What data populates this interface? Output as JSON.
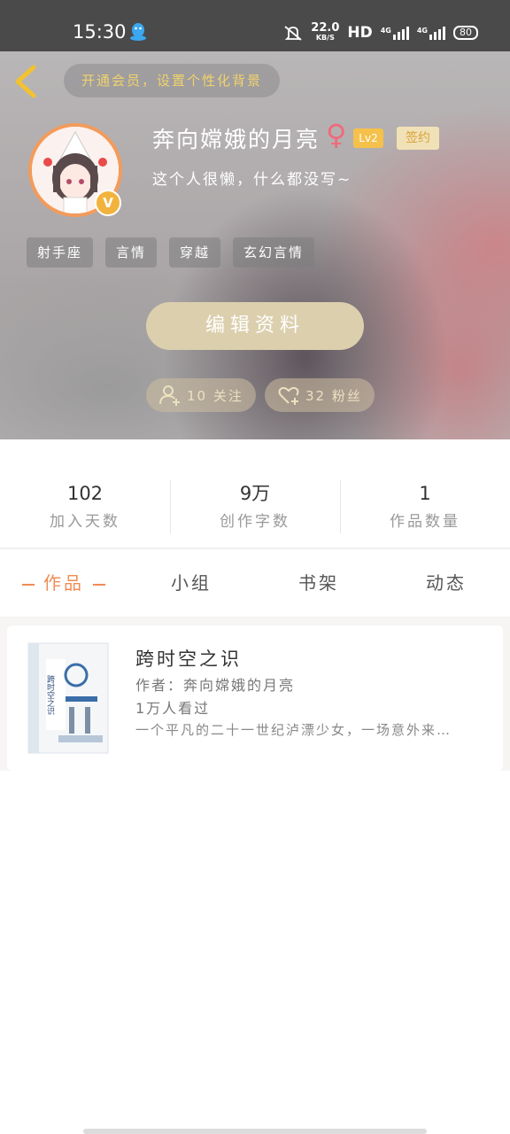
{
  "status_bar": {
    "time": "15:30",
    "speed_value": "22.0",
    "speed_unit": "KB/S",
    "hd": "HD",
    "signal1_label": "4G",
    "signal2_label": "4G",
    "battery": "80"
  },
  "header": {
    "vip_prompt": "开通会员，设置个性化背景",
    "username": "奔向嫦娥的月亮",
    "gender_symbol": "♀",
    "level": "Lv2",
    "signed_badge": "签约",
    "bio": "这个人很懒，什么都没写~",
    "avatar_badge": "V",
    "tags": [
      "射手座",
      "言情",
      "穿越",
      "玄幻言情"
    ],
    "edit_button": "编辑资料",
    "following": "10 关注",
    "followers": "32 粉丝"
  },
  "stats": [
    {
      "value": "102",
      "label": "加入天数"
    },
    {
      "value": "9万",
      "label": "创作字数"
    },
    {
      "value": "1",
      "label": "作品数量"
    }
  ],
  "tabs": [
    {
      "label": "作品",
      "active": true
    },
    {
      "label": "小组",
      "active": false
    },
    {
      "label": "书架",
      "active": false
    },
    {
      "label": "动态",
      "active": false
    }
  ],
  "works": [
    {
      "title": "跨时空之识",
      "author": "作者：奔向嫦娥的月亮",
      "views": "1万人看过",
      "description": "一个平凡的二十一世纪泸漂少女，一场意外来…",
      "cover_title": "跨时空之识"
    }
  ],
  "colors": {
    "accent": "#f08c54",
    "vip_text": "#f1d36a",
    "level_badge": "#f5c14a",
    "edit_button": "#dccfae",
    "gender": "#f06a7a"
  }
}
